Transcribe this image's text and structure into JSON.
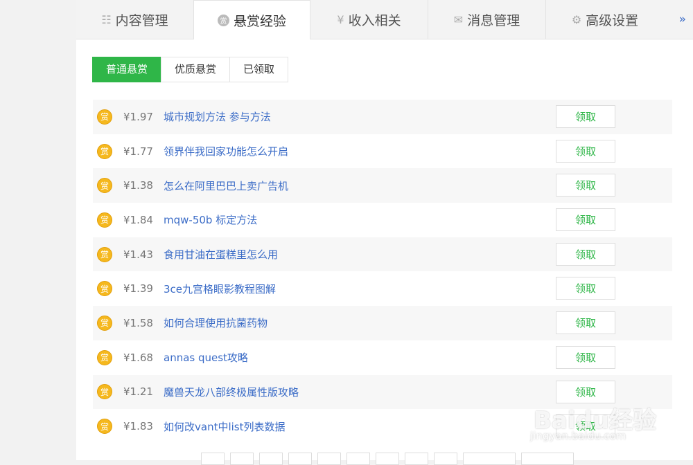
{
  "tabs": [
    {
      "label": "内容管理",
      "icon": "list-icon",
      "glyph": "☷"
    },
    {
      "label": "悬赏经验",
      "icon": "coin-icon",
      "glyph": "赏"
    },
    {
      "label": "收入相关",
      "icon": "yen-icon",
      "glyph": "¥"
    },
    {
      "label": "消息管理",
      "icon": "envelope-icon",
      "glyph": "✉"
    },
    {
      "label": "高级设置",
      "icon": "gear-icon",
      "glyph": "⚙"
    }
  ],
  "more_glyph": "»",
  "subtabs": [
    "普通悬赏",
    "优质悬赏",
    "已领取"
  ],
  "coin_glyph": "赏",
  "claim_label": "领取",
  "rewards": [
    {
      "amount": "¥1.97",
      "title": "城市规划方法 参与方法"
    },
    {
      "amount": "¥1.77",
      "title": "领界伴我回家功能怎么开启"
    },
    {
      "amount": "¥1.38",
      "title": "怎么在阿里巴巴上卖广告机"
    },
    {
      "amount": "¥1.84",
      "title": "mqw-50b 标定方法"
    },
    {
      "amount": "¥1.43",
      "title": "食用甘油在蛋糕里怎么用"
    },
    {
      "amount": "¥1.39",
      "title": "3ce九宫格眼影教程图解"
    },
    {
      "amount": "¥1.58",
      "title": "如何合理使用抗菌药物"
    },
    {
      "amount": "¥1.68",
      "title": "annas quest攻略"
    },
    {
      "amount": "¥1.21",
      "title": "魔兽天龙八部终极属性版攻略"
    },
    {
      "amount": "¥1.83",
      "title": "如何改vant中list列表数据"
    }
  ],
  "watermark": {
    "brand": "Baidu经验",
    "url": "jingyan.baidu.com"
  }
}
